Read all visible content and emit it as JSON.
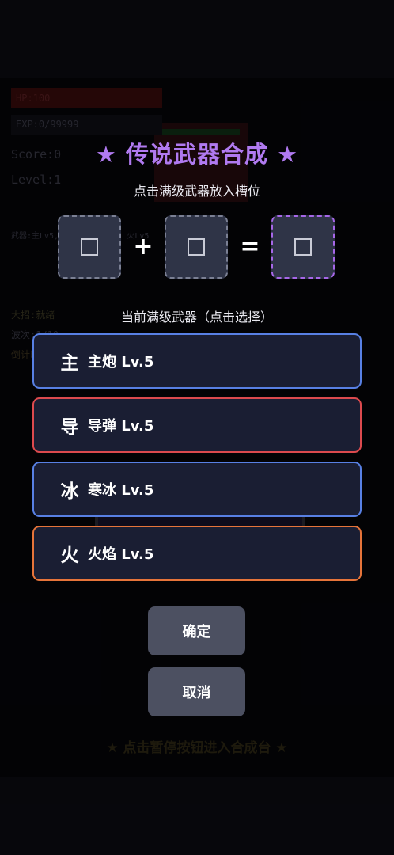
{
  "game": {
    "hp": "HP:100",
    "exp": "EXP:0/99999",
    "score": "Score:0",
    "level": "Level:1",
    "weapons": "武器:主Lv5, 导Lv5, 冰Lv5, 火Lv5",
    "ultimate": "大招:就绪",
    "wave": "波次:1/10",
    "countdown": "倒计时",
    "hint": "★ 点击暂停按钮进入合成台 ★"
  },
  "dialog": {
    "title": "★ 传说武器合成 ★",
    "subtitle": "点击满级武器放入槽位",
    "slots": [
      {
        "icon": "empty-square"
      },
      {
        "icon": "empty-square"
      },
      {
        "icon": "empty-square"
      }
    ],
    "plus_sign": "+",
    "equals_sign": "=",
    "list_title": "当前满级武器（点击选择）",
    "weapons": [
      {
        "icon": "主",
        "label": "主炮 Lv.5",
        "color": "#5880e4"
      },
      {
        "icon": "导",
        "label": "导弹 Lv.5",
        "color": "#dc4a4e"
      },
      {
        "icon": "冰",
        "label": "寒冰 Lv.5",
        "color": "#5880e4"
      },
      {
        "icon": "火",
        "label": "火焰 Lv.5",
        "color": "#e6743a"
      }
    ],
    "confirm_label": "确定",
    "cancel_label": "取消"
  },
  "colors": {
    "title": "#b07af0",
    "slot_bg": "#2f3447",
    "result_slot_border": "#a667e8",
    "button_bg": "#4c5061",
    "card_bg": "#1a1e33"
  }
}
